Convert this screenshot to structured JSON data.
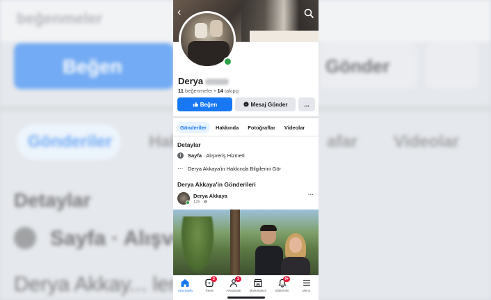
{
  "backdrop": {
    "top_text": "beğenmeler",
    "like_label": "Beğen",
    "send_label": "Gönder",
    "tab_active": "Gönderiler",
    "tab_2": "Hakkında",
    "tab_3": "afar",
    "tab_4": "Videolar",
    "details_title": "Detaylar",
    "page_row": "Sayfa · Alışve",
    "about_row": "Derya Akkay... lerini Gör"
  },
  "profile": {
    "name": "Derya",
    "likes_count": "11",
    "likes_label": "beğenmeler",
    "followers_count": "14",
    "followers_label": "takipçi",
    "online": true
  },
  "actions": {
    "like_label": "Beğen",
    "message_label": "Mesaj Gönder",
    "more_label": "..."
  },
  "tabs": [
    {
      "label": "Gönderiler",
      "active": true
    },
    {
      "label": "Hakkında",
      "active": false
    },
    {
      "label": "Fotoğraflar",
      "active": false
    },
    {
      "label": "Videolar",
      "active": false
    }
  ],
  "details": {
    "title": "Detaylar",
    "page_type_bold": "Sayfa",
    "page_type_rest": " · Alışveriş Hizmeti",
    "see_about": "Derya Akkaya'in Hakkında Bilgilerini Gör"
  },
  "posts_section": {
    "title": "Derya Akkaya'in Gönderileri"
  },
  "post": {
    "author": "Derya Akkaya",
    "time": "12s ·",
    "more": "···"
  },
  "bottom_nav": [
    {
      "label": "Ana Sayfa",
      "icon": "home-icon",
      "badge": "",
      "active": true
    },
    {
      "label": "Reels",
      "icon": "reels-icon",
      "badge": "2",
      "active": false
    },
    {
      "label": "Arkadaşlar",
      "icon": "friends-icon",
      "badge": "1",
      "active": false
    },
    {
      "label": "Marketplace",
      "icon": "marketplace-icon",
      "badge": "",
      "active": false
    },
    {
      "label": "Bildirimler",
      "icon": "bell-icon",
      "badge": "9+",
      "active": false
    },
    {
      "label": "Menü",
      "icon": "menu-icon",
      "badge": "",
      "active": false
    }
  ],
  "colors": {
    "accent": "#1877f2",
    "online": "#31a24c",
    "badge": "#e41e3f"
  }
}
